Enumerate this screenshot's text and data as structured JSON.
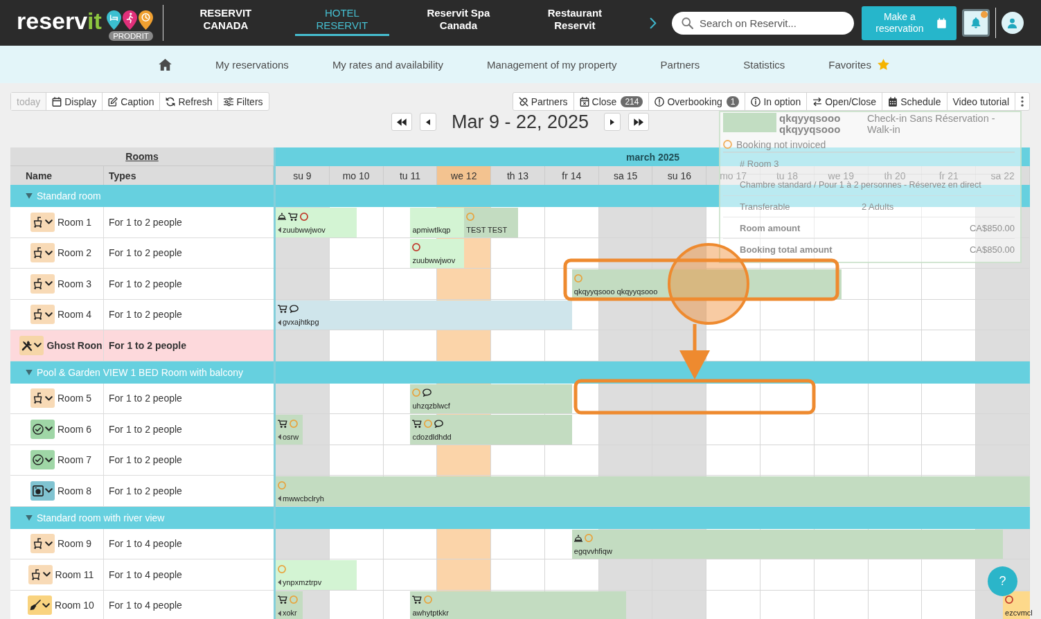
{
  "top_bar": {
    "logo": {
      "text": "reserv",
      "accent": "it",
      "badge": "PRODRIT"
    },
    "tabs": [
      {
        "label": "RESERVIT CANADA",
        "selected": false
      },
      {
        "label": "HOTEL RESERVIT",
        "selected": true
      },
      {
        "label": "Reservit Spa Canada",
        "selected": false
      },
      {
        "label": "Restaurant Reservit",
        "selected": false
      }
    ],
    "search": {
      "placeholder": "Search on Reservit..."
    },
    "reserve_button": {
      "label": "Make a reservation"
    },
    "notifications": {
      "unread": true
    }
  },
  "nav": {
    "items": [
      {
        "kind": "home"
      },
      {
        "kind": "link",
        "label": "My reservations"
      },
      {
        "kind": "link",
        "label": "My rates and availability"
      },
      {
        "kind": "link",
        "label": "Management of my property"
      },
      {
        "kind": "link",
        "label": "Partners"
      },
      {
        "kind": "link",
        "label": "Statistics"
      },
      {
        "kind": "favorites",
        "label": "Favorites"
      }
    ]
  },
  "toolbar": {
    "left": [
      {
        "kind": "plain",
        "label": "today",
        "disabled": true
      },
      {
        "kind": "calendar",
        "label": "Display",
        "disabled": false
      },
      {
        "kind": "edit",
        "label": "Caption",
        "disabled": false
      },
      {
        "kind": "refresh",
        "label": "Refresh",
        "disabled": false
      },
      {
        "kind": "sliders",
        "label": "Filters",
        "disabled": false
      }
    ],
    "right": [
      {
        "kind": "unlink",
        "label": "Partners",
        "disabled": false
      },
      {
        "kind": "calendar_x",
        "label": "Close",
        "count": "214",
        "disabled": false
      },
      {
        "kind": "alert",
        "label": "Overbooking",
        "count": "1",
        "disabled": false
      },
      {
        "kind": "info",
        "label": "In option",
        "disabled": false
      },
      {
        "kind": "swap",
        "label": "Open/Close",
        "disabled": false
      },
      {
        "kind": "grid",
        "label": "Schedule",
        "disabled": false
      },
      {
        "kind": "plain",
        "label": "Video tutorial",
        "disabled": false
      },
      {
        "kind": "more",
        "disabled": false
      }
    ]
  },
  "date_nav": {
    "items": [
      {
        "kind": "fast_back"
      },
      {
        "kind": "back"
      },
      {
        "kind": "title",
        "label": "Mar 9 - 22, 2025"
      },
      {
        "kind": "forward"
      },
      {
        "kind": "fast_forward"
      }
    ]
  },
  "grid": {
    "rooms_header": "Rooms",
    "columns": [
      "Name",
      "Types"
    ],
    "month": "march 2025",
    "days": [
      {
        "label": "su 9",
        "today": false,
        "weekend": true
      },
      {
        "label": "mo 10",
        "today": false,
        "weekend": false
      },
      {
        "label": "tu 11",
        "today": false,
        "weekend": false
      },
      {
        "label": "we 12",
        "today": true,
        "weekend": false
      },
      {
        "label": "th 13",
        "today": false,
        "weekend": false
      },
      {
        "label": "fr 14",
        "today": false,
        "weekend": false
      },
      {
        "label": "sa 15",
        "today": false,
        "weekend": true
      },
      {
        "label": "su 16",
        "today": false,
        "weekend": true
      },
      {
        "label": "mo 17",
        "today": false,
        "weekend": false
      },
      {
        "label": "tu 18",
        "today": false,
        "weekend": false
      },
      {
        "label": "we 19",
        "today": false,
        "weekend": false
      },
      {
        "label": "th 20",
        "today": false,
        "weekend": false
      },
      {
        "label": "fr 21",
        "today": false,
        "weekend": false
      },
      {
        "label": "sa 22",
        "today": false,
        "weekend": true
      }
    ],
    "categories": [
      {
        "name": "Standard room",
        "expanded": true,
        "rooms": [
          {
            "name": "Room 1",
            "type": "For 1 to 2 people",
            "highlighted": false,
            "housekeeping": {
              "kind": "bucket",
              "color": "#f8dab6"
            },
            "days": [
              {
                "kind": "through",
                "booking": {
                  "name": "zuubwwjwov",
                  "color": "#d3f4d3",
                  "icons": [
                    {
                      "kind": "cloche"
                    },
                    {
                      "kind": "cart"
                    },
                    {
                      "kind": "ring",
                      "color": "#c0392b"
                    }
                  ]
                }
              },
              {
                "kind": "out"
              },
              {
                "kind": "in",
                "booking": {
                  "name": "apmiwtlkqp",
                  "color": "#d3f4d3"
                }
              },
              {
                "kind": "swap",
                "booking": {
                  "name": "TEST TEST",
                  "color": "#c3dcc1",
                  "icons": [
                    {
                      "kind": "ring",
                      "color": "#e8a33d"
                    }
                  ]
                }
              },
              {
                "kind": "out"
              },
              {
                "kind": "free"
              },
              {
                "kind": "free"
              },
              {
                "kind": "free"
              },
              {
                "kind": "free"
              },
              {
                "kind": "free"
              },
              {
                "kind": "free"
              },
              {
                "kind": "free"
              },
              {
                "kind": "free"
              },
              {
                "kind": "free"
              }
            ]
          },
          {
            "name": "Room 2",
            "type": "For 1 to 2 people",
            "highlighted": false,
            "housekeeping": {
              "kind": "bucket",
              "color": "#f8dab6"
            },
            "days": [
              {
                "kind": "free"
              },
              {
                "kind": "free"
              },
              {
                "kind": "in",
                "booking": {
                  "name": "zuubwwjwov",
                  "color": "#d3f4d3",
                  "icons": [
                    {
                      "kind": "ring",
                      "color": "#c0392b"
                    }
                  ]
                }
              },
              {
                "kind": "out"
              },
              {
                "kind": "free"
              },
              {
                "kind": "free"
              },
              {
                "kind": "free"
              },
              {
                "kind": "free"
              },
              {
                "kind": "free"
              },
              {
                "kind": "free"
              },
              {
                "kind": "free"
              },
              {
                "kind": "free"
              },
              {
                "kind": "free"
              },
              {
                "kind": "free"
              }
            ]
          },
          {
            "name": "Room 3",
            "type": "For 1 to 2 people",
            "highlighted": false,
            "housekeeping": {
              "kind": "bucket",
              "color": "#f8dab6"
            },
            "days": [
              {
                "kind": "free"
              },
              {
                "kind": "free"
              },
              {
                "kind": "free"
              },
              {
                "kind": "free"
              },
              {
                "kind": "free"
              },
              {
                "kind": "in",
                "booking": {
                  "name": "qkqyyqsooo qkqyyqsooo",
                  "color": "#c3dcc1",
                  "icons": [
                    {
                      "kind": "ring",
                      "color": "#e8a33d"
                    }
                  ]
                }
              },
              {
                "kind": "through"
              },
              {
                "kind": "through"
              },
              {
                "kind": "through"
              },
              {
                "kind": "through"
              },
              {
                "kind": "out"
              },
              {
                "kind": "free"
              },
              {
                "kind": "free"
              },
              {
                "kind": "free"
              }
            ]
          },
          {
            "name": "Room 4",
            "type": "For 1 to 2 people",
            "highlighted": false,
            "housekeeping": {
              "kind": "bucket",
              "color": "#f8dab6"
            },
            "days": [
              {
                "kind": "through",
                "booking": {
                  "name": "gvxajhtkpg",
                  "color": "#cfe5eb",
                  "icons": [
                    {
                      "kind": "cart"
                    },
                    {
                      "kind": "bubble"
                    }
                  ]
                }
              },
              {
                "kind": "through"
              },
              {
                "kind": "through"
              },
              {
                "kind": "through"
              },
              {
                "kind": "through"
              },
              {
                "kind": "out"
              },
              {
                "kind": "free"
              },
              {
                "kind": "free"
              },
              {
                "kind": "free"
              },
              {
                "kind": "free"
              },
              {
                "kind": "free"
              },
              {
                "kind": "free"
              },
              {
                "kind": "free"
              },
              {
                "kind": "free"
              }
            ]
          },
          {
            "name": "Ghost Roon",
            "type": "For 1 to 2 people",
            "highlighted": true,
            "housekeeping": {
              "kind": "tools",
              "color": "#f6d6a8"
            },
            "days": [
              {
                "kind": "free"
              },
              {
                "kind": "free"
              },
              {
                "kind": "free"
              },
              {
                "kind": "free"
              },
              {
                "kind": "free"
              },
              {
                "kind": "free"
              },
              {
                "kind": "free"
              },
              {
                "kind": "free"
              },
              {
                "kind": "free"
              },
              {
                "kind": "free"
              },
              {
                "kind": "free"
              },
              {
                "kind": "free"
              },
              {
                "kind": "free"
              },
              {
                "kind": "free"
              }
            ]
          }
        ]
      },
      {
        "name": "Pool & Garden VIEW 1 BED Room with balcony",
        "expanded": true,
        "rooms": [
          {
            "name": "Room 5",
            "type": "For 1 to 2 people",
            "highlighted": false,
            "housekeeping": {
              "kind": "bucket",
              "color": "#f8dab6"
            },
            "days": [
              {
                "kind": "free"
              },
              {
                "kind": "free"
              },
              {
                "kind": "in",
                "booking": {
                  "name": "uhzqzblwcf",
                  "color": "#c3dcc1",
                  "icons": [
                    {
                      "kind": "ring",
                      "color": "#e8a33d"
                    },
                    {
                      "kind": "bubble"
                    }
                  ]
                }
              },
              {
                "kind": "through"
              },
              {
                "kind": "through"
              },
              {
                "kind": "out"
              },
              {
                "kind": "free"
              },
              {
                "kind": "free"
              },
              {
                "kind": "free"
              },
              {
                "kind": "free"
              },
              {
                "kind": "free"
              },
              {
                "kind": "free"
              },
              {
                "kind": "free"
              },
              {
                "kind": "free"
              }
            ]
          },
          {
            "name": "Room 6",
            "type": "For 1 to 2 people",
            "highlighted": false,
            "housekeeping": {
              "kind": "check",
              "color": "#9fd6a6"
            },
            "days": [
              {
                "kind": "out",
                "booking": {
                  "name": "osrw",
                  "color": "#c3dcc1",
                  "icons": [
                    {
                      "kind": "cart"
                    },
                    {
                      "kind": "ring",
                      "color": "#e8a33d"
                    }
                  ]
                }
              },
              {
                "kind": "free"
              },
              {
                "kind": "in",
                "booking": {
                  "name": "cdozdldhdd",
                  "color": "#c3dcc1",
                  "icons": [
                    {
                      "kind": "cart"
                    },
                    {
                      "kind": "ring",
                      "color": "#e8a33d"
                    },
                    {
                      "kind": "bubble"
                    }
                  ]
                }
              },
              {
                "kind": "through"
              },
              {
                "kind": "through"
              },
              {
                "kind": "out"
              },
              {
                "kind": "free"
              },
              {
                "kind": "free"
              },
              {
                "kind": "free"
              },
              {
                "kind": "free"
              },
              {
                "kind": "free"
              },
              {
                "kind": "free"
              },
              {
                "kind": "free"
              },
              {
                "kind": "free"
              }
            ]
          },
          {
            "name": "Room 7",
            "type": "For 1 to 2 people",
            "highlighted": false,
            "housekeeping": {
              "kind": "check",
              "color": "#9fd6a6"
            },
            "days": [
              {
                "kind": "free"
              },
              {
                "kind": "free"
              },
              {
                "kind": "free"
              },
              {
                "kind": "free"
              },
              {
                "kind": "free"
              },
              {
                "kind": "free"
              },
              {
                "kind": "free"
              },
              {
                "kind": "free"
              },
              {
                "kind": "free"
              },
              {
                "kind": "free"
              },
              {
                "kind": "free"
              },
              {
                "kind": "free"
              },
              {
                "kind": "free"
              },
              {
                "kind": "free"
              }
            ]
          },
          {
            "name": "Room 8",
            "type": "For 1 to 2 people",
            "highlighted": false,
            "housekeeping": {
              "kind": "washer",
              "color": "#80c3d1"
            },
            "days": [
              {
                "kind": "through",
                "booking": {
                  "name": "mwwcbclryh",
                  "color": "#c3dcc1",
                  "icons": [
                    {
                      "kind": "ring",
                      "color": "#e8a33d"
                    }
                  ]
                }
              },
              {
                "kind": "through"
              },
              {
                "kind": "through"
              },
              {
                "kind": "through"
              },
              {
                "kind": "through"
              },
              {
                "kind": "through"
              },
              {
                "kind": "through"
              },
              {
                "kind": "through"
              },
              {
                "kind": "through"
              },
              {
                "kind": "through"
              },
              {
                "kind": "through"
              },
              {
                "kind": "through"
              },
              {
                "kind": "through"
              },
              {
                "kind": "through"
              }
            ]
          }
        ]
      },
      {
        "name": "Standard room with river view",
        "expanded": true,
        "rooms": [
          {
            "name": "Room 9",
            "type": "For 1 to 4 people",
            "highlighted": false,
            "housekeeping": {
              "kind": "bucket",
              "color": "#f8dab6"
            },
            "days": [
              {
                "kind": "free"
              },
              {
                "kind": "free"
              },
              {
                "kind": "free"
              },
              {
                "kind": "free"
              },
              {
                "kind": "free"
              },
              {
                "kind": "in",
                "booking": {
                  "name": "egqvvhfiqw",
                  "color": "#c3dcc1",
                  "icons": [
                    {
                      "kind": "cloche"
                    },
                    {
                      "kind": "ring",
                      "color": "#e8a33d"
                    }
                  ]
                }
              },
              {
                "kind": "through"
              },
              {
                "kind": "through"
              },
              {
                "kind": "through"
              },
              {
                "kind": "through"
              },
              {
                "kind": "through"
              },
              {
                "kind": "through"
              },
              {
                "kind": "through"
              },
              {
                "kind": "out"
              }
            ]
          },
          {
            "name": "Room 11",
            "type": "For 1 to 4 people",
            "highlighted": false,
            "housekeeping": {
              "kind": "bucket",
              "color": "#f8dab6"
            },
            "days": [
              {
                "kind": "through",
                "booking": {
                  "name": "ynpxmztrpv",
                  "color": "#d3f4d3",
                  "icons": [
                    {
                      "kind": "ring",
                      "color": "#e8a33d"
                    }
                  ]
                }
              },
              {
                "kind": "out"
              },
              {
                "kind": "free"
              },
              {
                "kind": "free"
              },
              {
                "kind": "free"
              },
              {
                "kind": "free"
              },
              {
                "kind": "free"
              },
              {
                "kind": "free"
              },
              {
                "kind": "free"
              },
              {
                "kind": "free"
              },
              {
                "kind": "free"
              },
              {
                "kind": "free"
              },
              {
                "kind": "free"
              },
              {
                "kind": "free"
              }
            ]
          },
          {
            "name": "Room 10",
            "type": "For 1 to 4 people",
            "highlighted": false,
            "housekeeping": {
              "kind": "broom",
              "color": "#f9d37f"
            },
            "days": [
              {
                "kind": "out",
                "booking": {
                  "name": "xokr",
                  "color": "#c3dcc1",
                  "icons": [
                    {
                      "kind": "cart"
                    },
                    {
                      "kind": "ring",
                      "color": "#e8a33d"
                    }
                  ]
                }
              },
              {
                "kind": "free"
              },
              {
                "kind": "in",
                "booking": {
                  "name": "awhytptkkr",
                  "color": "#c3dcc1",
                  "icons": [
                    {
                      "kind": "cart"
                    },
                    {
                      "kind": "ring",
                      "color": "#e8a33d"
                    }
                  ]
                }
              },
              {
                "kind": "through"
              },
              {
                "kind": "through"
              },
              {
                "kind": "through"
              },
              {
                "kind": "out"
              },
              {
                "kind": "free"
              },
              {
                "kind": "free"
              },
              {
                "kind": "free"
              },
              {
                "kind": "free"
              },
              {
                "kind": "free"
              },
              {
                "kind": "free"
              },
              {
                "kind": "in",
                "booking": {
                  "name": "ezcvmcl",
                  "color": "#fdd98b",
                  "icons": [
                    {
                      "kind": "ring",
                      "color": "#c0392b"
                    }
                  ]
                }
              }
            ]
          }
        ]
      }
    ]
  },
  "tooltip": {
    "title": "qkqyyqsooo qkqyyqsooo",
    "source": "Check-in Sans Réservation - Walk-in",
    "status": "Booking not invoiced",
    "room": "# Room 3",
    "room_type": "Chambre standard / Pour 1 à 2 personnes - Réservez en direct",
    "rows": [
      {
        "kind": "plain",
        "label": "Transferable",
        "value": "2 Adults"
      },
      {
        "kind": "amount",
        "label": "Room amount",
        "value": "CA$850.00"
      },
      {
        "kind": "amount",
        "label": "Booking total amount",
        "value": "CA$850.00"
      }
    ]
  },
  "annotation": {
    "kind": "move"
  },
  "help": {
    "label": "?"
  }
}
